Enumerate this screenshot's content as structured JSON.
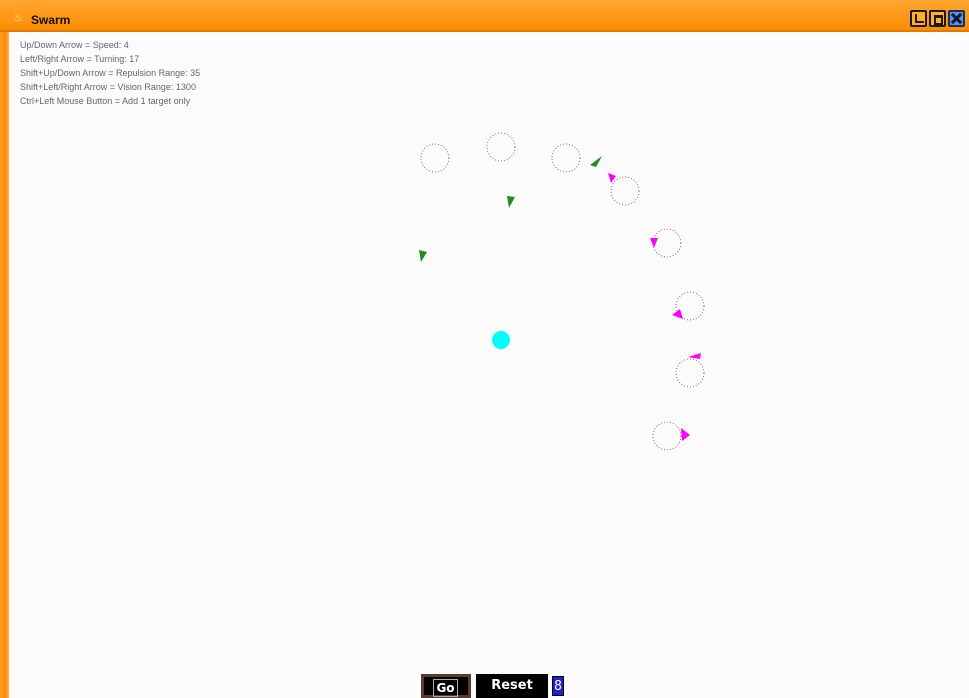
{
  "window": {
    "title": "Swarm",
    "app_icon": "java-cup-icon"
  },
  "window_controls": {
    "minimize": "minimize-icon",
    "maximize": "maximize-icon",
    "close": "close-icon"
  },
  "help": {
    "speed": "Up/Down Arrow = Speed: 4",
    "turning": "Left/Right Arrow = Turning: 17",
    "repulsion": "Shift+Up/Down Arrow = Repulsion Range: 35",
    "vision": "Shift+Left/Right Arrow = Vision Range: 1300",
    "target": "Ctrl+Left Mouse Button = Add 1 target only"
  },
  "controls": {
    "go_label": "Go",
    "reset_label": "Reset",
    "count_value": "8"
  },
  "colors": {
    "title_bar": "#ff9a1a",
    "target": "#00ffff",
    "tracking_agent": "#ff00ff",
    "free_agent": "#228b22",
    "ring": "#777777"
  }
}
